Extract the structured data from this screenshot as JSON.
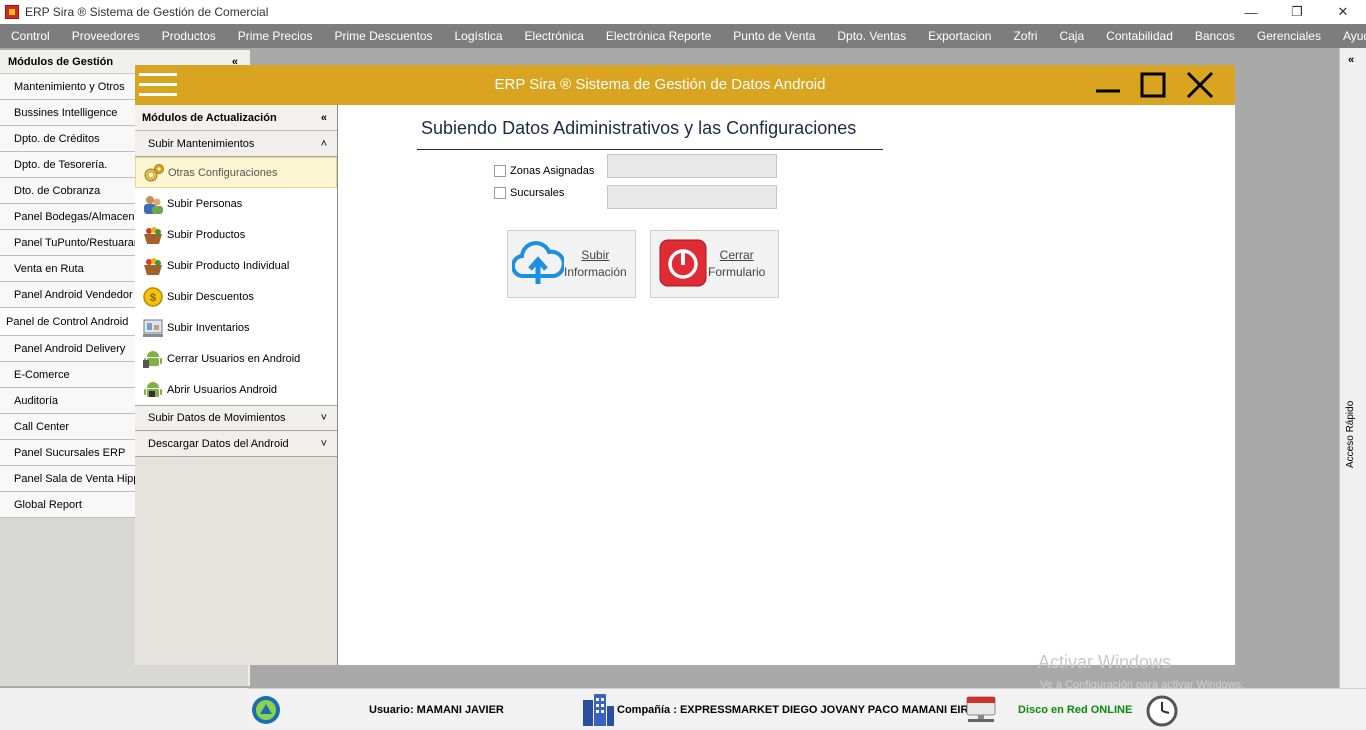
{
  "app": {
    "title": "ERP Sira ® Sistema de Gestión de Comercial"
  },
  "menu": [
    "Control",
    "Proveedores",
    "Productos",
    "Prime Precios",
    "Prime Descuentos",
    "Logística",
    "Electrónica",
    "Electrónica Reporte",
    "Punto de Venta",
    "Dpto. Ventas",
    "Exportacion",
    "Zofri",
    "Caja",
    "Contabilidad",
    "Bancos",
    "Gerenciales",
    "Ayuda"
  ],
  "leftnav": {
    "header": "Módulos de Gestión",
    "items": [
      "Mantenimiento y Otros",
      "Bussines Intelligence",
      "Dpto. de Créditos",
      "Dpto. de Tesorería.",
      "Dto. de Cobranza",
      "Panel Bodegas/Almacenes",
      "Panel TuPunto/Restuarant",
      "Venta en Ruta",
      "Panel Android Vendedor",
      "Panel de Control Android",
      "Panel Android Delivery",
      "E-Comerce",
      "Auditoría",
      "Call Center",
      "Panel Sucursales ERP",
      "Panel Sala de Venta Hipp",
      "Global Report"
    ]
  },
  "rightbar": {
    "label": "Acceso Rápido"
  },
  "window": {
    "title": "ERP Sira ® Sistema de Gestión de Datos Android",
    "sidebar": {
      "header": "Módulos de Actualización",
      "group1": "Subir Mantenimientos",
      "items": [
        {
          "label": "Otras Configuraciones",
          "icon": "gears-icon"
        },
        {
          "label": "Subir Personas",
          "icon": "people-icon"
        },
        {
          "label": "Subir Productos",
          "icon": "basket-icon"
        },
        {
          "label": "Subir Producto Individual",
          "icon": "basket-icon"
        },
        {
          "label": "Subir Descuentos",
          "icon": "coin-icon"
        },
        {
          "label": "Subir Inventarios",
          "icon": "inventory-icon"
        },
        {
          "label": "Cerrar Usuarios en Android",
          "icon": "android-icon"
        },
        {
          "label": "Abrir Usuarios Android",
          "icon": "android-lock-icon"
        }
      ],
      "group2": "Subir Datos de Movimientos",
      "group3": "Descargar Datos del Android"
    },
    "form": {
      "title": "Subiendo Datos Adiministrativos y las Configuraciones",
      "zonas_label": "Zonas Asignadas",
      "sucursales_label": "Sucursales",
      "upload_btn": [
        "Subir",
        "Información"
      ],
      "close_btn": [
        "Cerrar",
        "Formulario"
      ]
    }
  },
  "status": {
    "user": "Usuario: MAMANI JAVIER",
    "company": "Compañía : EXPRESSMARKET DIEGO JOVANY PACO MAMANI EIRL",
    "network": "Disco en Red ONLINE",
    "network_color": "#0a8a0a"
  },
  "watermark": {
    "line1": "Activar Windows",
    "line2": "Ve a Configuración para activar Windows."
  }
}
